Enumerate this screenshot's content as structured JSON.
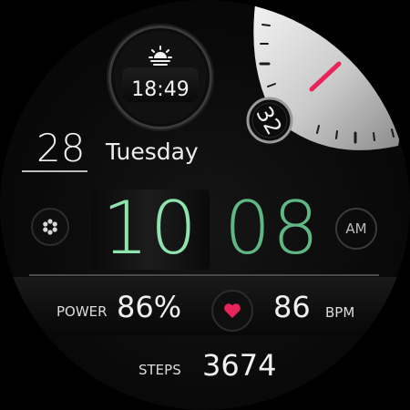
{
  "sunrise": {
    "time": "18:49",
    "icon": "sunrise-icon"
  },
  "seconds": {
    "value": "32"
  },
  "date": {
    "day": "28",
    "weekday": "Tuesday"
  },
  "time": {
    "hour": "10",
    "minute": "08",
    "period": "AM"
  },
  "stats": {
    "power_label": "POWER",
    "power_value": "86%",
    "heart_rate_value": "86",
    "heart_rate_unit": "BPM",
    "steps_label": "STEPS",
    "steps_value": "3674"
  },
  "icons": {
    "apps": "apps-icon",
    "heart": "heart-icon"
  },
  "colors": {
    "hour": "#8fe3ad",
    "minute": "#5fb883",
    "heart": "#e8245a",
    "needle": "#e8245a"
  }
}
